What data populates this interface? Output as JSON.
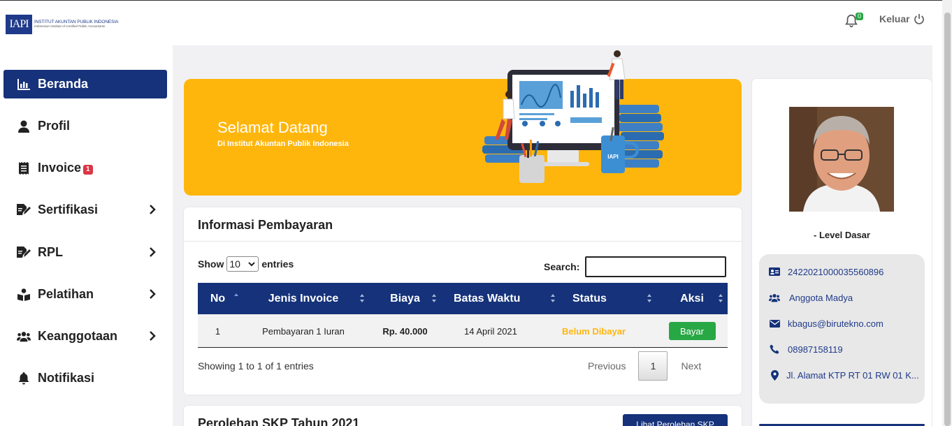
{
  "header": {
    "logo_mark": "IAPI",
    "logo_line1": "INSTITUT AKUNTAN PUBLIK INDONESIA",
    "logo_line2": "Indonesian Institute of Certified Public Accountants",
    "notification_count": "0",
    "logout_label": "Keluar"
  },
  "sidebar": {
    "items": [
      {
        "label": "Beranda",
        "icon": "chart-icon",
        "active": true
      },
      {
        "label": "Profil",
        "icon": "user-icon"
      },
      {
        "label": "Invoice",
        "icon": "receipt-icon",
        "badge": "1"
      },
      {
        "label": "Sertifikasi",
        "icon": "edit-doc-icon",
        "has_children": true
      },
      {
        "label": "RPL",
        "icon": "edit-doc-icon",
        "has_children": true
      },
      {
        "label": "Pelatihan",
        "icon": "reader-icon",
        "has_children": true
      },
      {
        "label": "Keanggotaan",
        "icon": "users-icon",
        "has_children": true
      },
      {
        "label": "Notifikasi",
        "icon": "bell-icon"
      }
    ]
  },
  "banner": {
    "title": "Selamat Datang",
    "subtitle": "Di Institut Akuntan Publik Indonesia",
    "mug_label": "IAPI"
  },
  "payment": {
    "title": "Informasi Pembayaran",
    "show_label": "Show",
    "entries_value": "10",
    "entries_label": "entries",
    "search_label": "Search:",
    "search_value": "",
    "columns": [
      "No",
      "Jenis Invoice",
      "Biaya",
      "Batas Waktu",
      "Status",
      "Aksi"
    ],
    "rows": [
      {
        "no": "1",
        "jenis": "Pembayaran 1 Iuran",
        "biaya": "Rp. 40.000",
        "batas": "14 April 2021",
        "status": "Belum Dibayar",
        "aksi": "Bayar"
      }
    ],
    "info": "Showing 1 to 1 of 1 entries",
    "prev_label": "Previous",
    "page": "1",
    "next_label": "Next"
  },
  "skp": {
    "title": "Perolehan SKP Tahun 2021",
    "button_label": "Lihat Perolehan SKP"
  },
  "profile": {
    "level": "- Level Dasar",
    "id_number": "2422021000035560896",
    "membership": "Anggota Madya",
    "email": "kbagus@birutekno.com",
    "phone": "08987158119",
    "address": "Jl. Alamat KTP RT 01 RW 01 K..."
  },
  "colors": {
    "primary": "#15327a",
    "banner": "#ffb60c",
    "success": "#28a745",
    "danger": "#dc3545",
    "background": "#f1f1f4"
  }
}
